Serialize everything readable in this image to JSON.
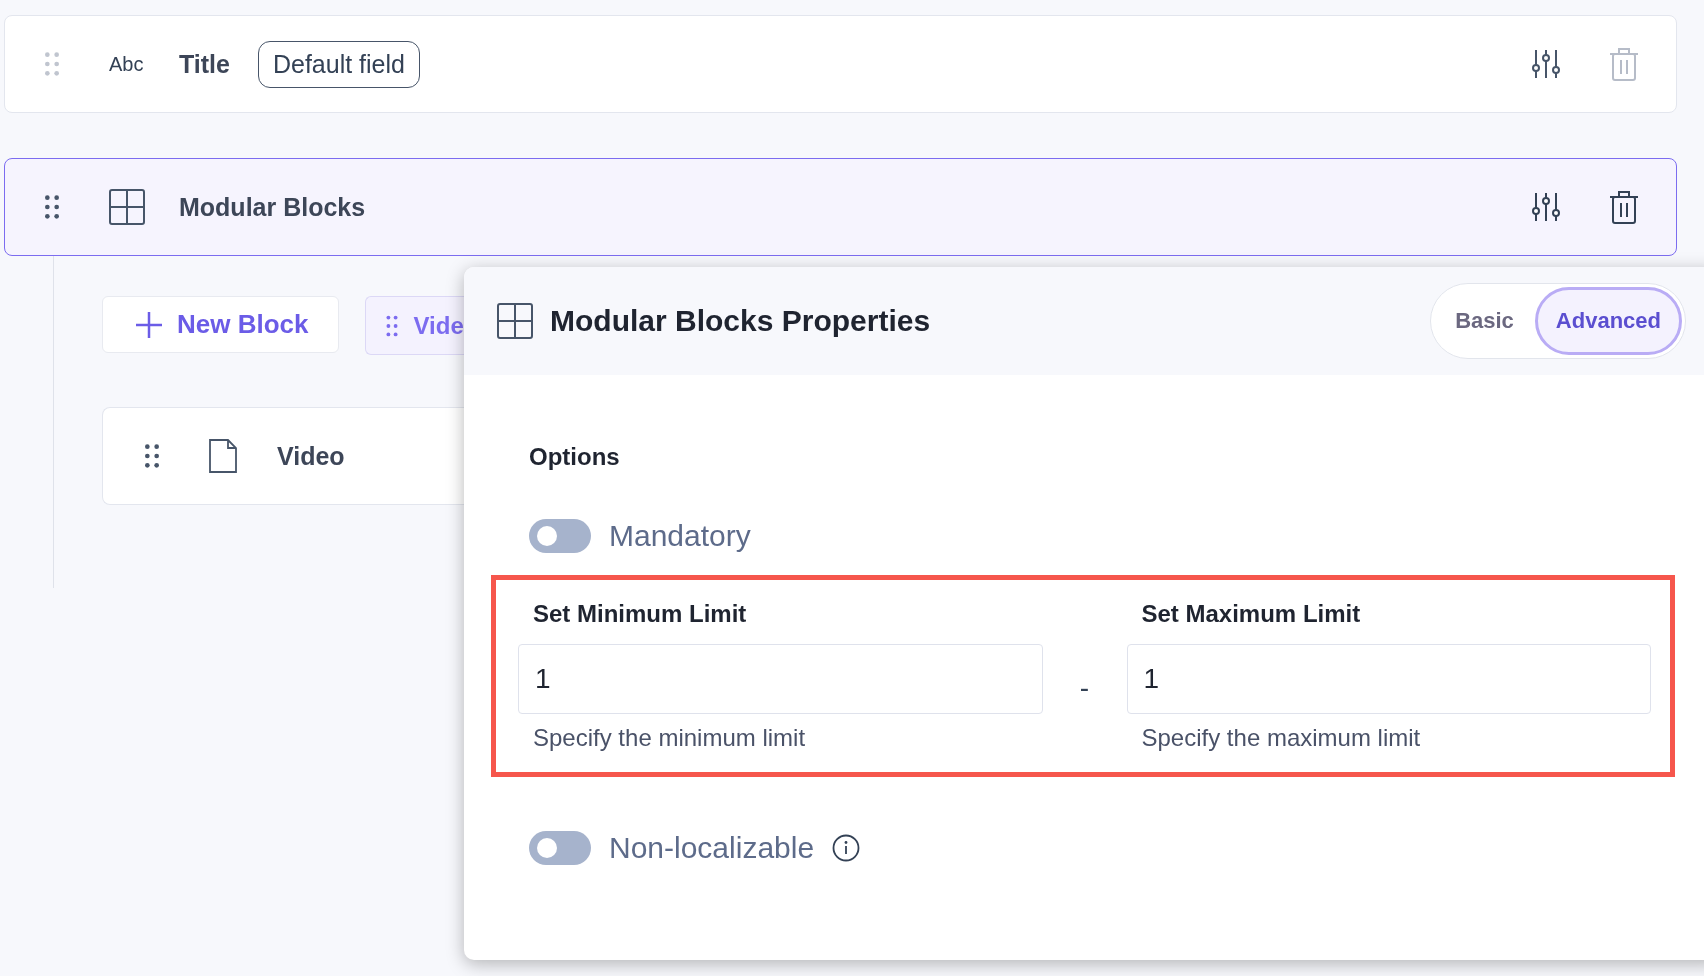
{
  "fields": [
    {
      "kind": "text",
      "type_label": "Abc",
      "name": "Title",
      "badge": "Default field",
      "selected": false
    },
    {
      "kind": "modular",
      "name": "Modular Blocks",
      "selected": true
    }
  ],
  "blocks_toolbar": {
    "new_block": "New Block",
    "block_chip": "Vide"
  },
  "blocks": [
    {
      "name": "Video"
    }
  ],
  "panel": {
    "title": "Modular Blocks Properties",
    "tabs": [
      {
        "label": "Basic",
        "selected": false
      },
      {
        "label": "Advanced",
        "selected": true
      }
    ],
    "section": "Options",
    "mandatory": {
      "label": "Mandatory",
      "on": false
    },
    "limits": {
      "highlighted": true,
      "separator": "-",
      "min": {
        "label": "Set Minimum Limit",
        "value": "1",
        "help": "Specify the minimum limit"
      },
      "max": {
        "label": "Set Maximum Limit",
        "value": "1",
        "help": "Specify the maximum limit"
      }
    },
    "non_localizable": {
      "label": "Non-localizable",
      "on": false,
      "info": true
    }
  }
}
